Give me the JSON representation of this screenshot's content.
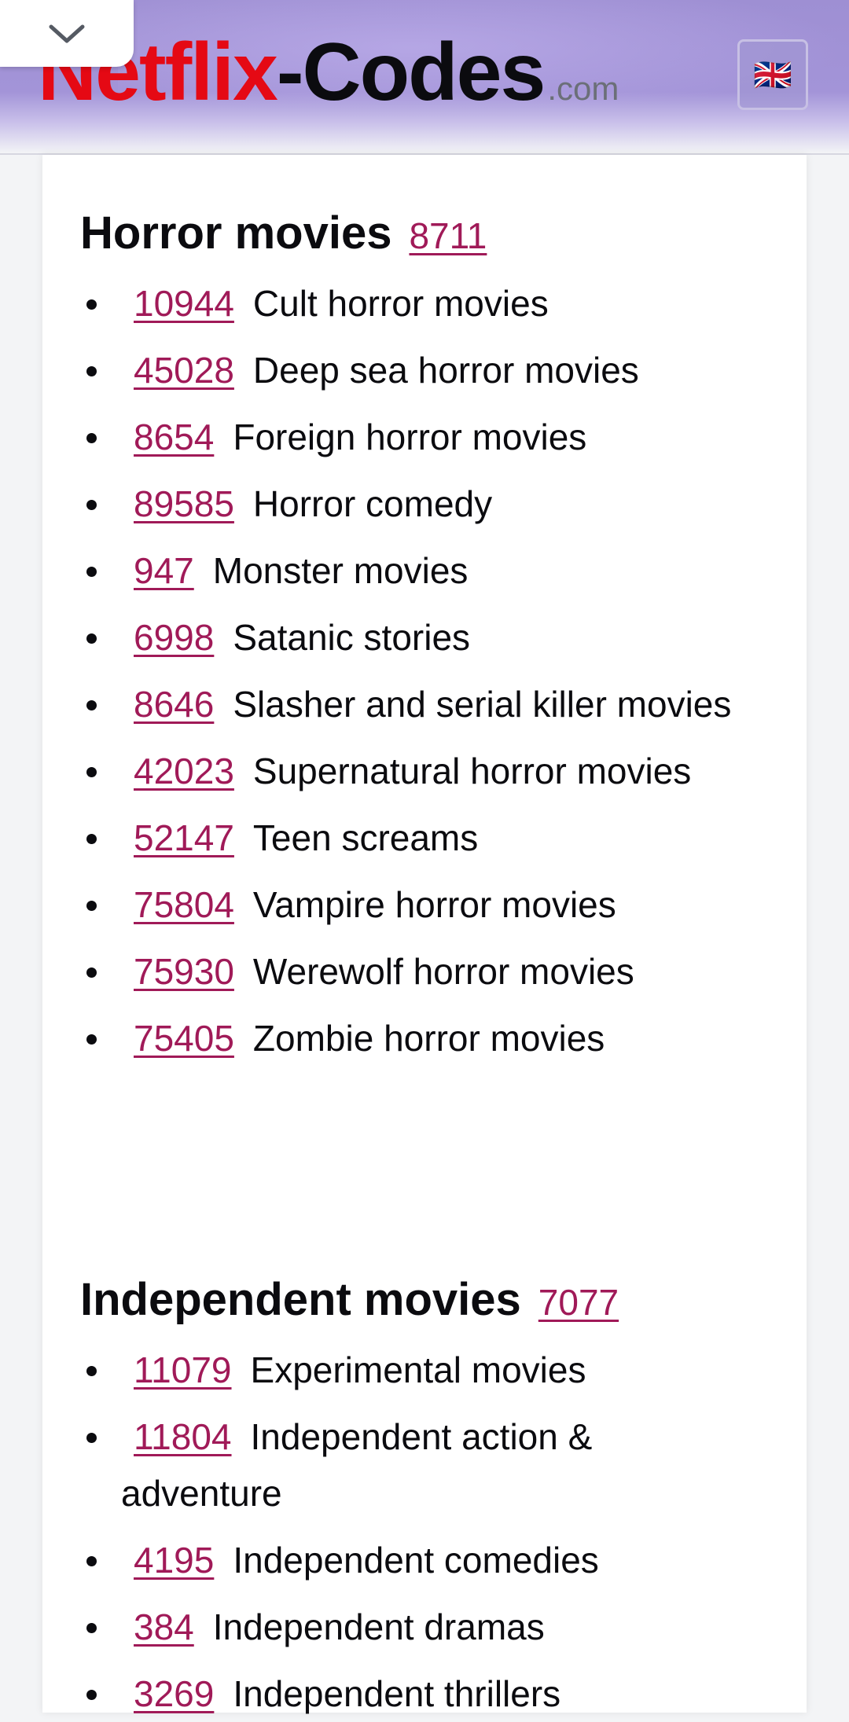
{
  "header": {
    "logo_part1": "Netflix",
    "logo_part2": "-Codes",
    "logo_suffix": ".com",
    "language_flag": "🇬🇧"
  },
  "sections": [
    {
      "title": "Horror movies",
      "code": "8711",
      "items": [
        {
          "code": "10944",
          "label": "Cult horror movies"
        },
        {
          "code": "45028",
          "label": "Deep sea horror movies"
        },
        {
          "code": "8654",
          "label": "Foreign horror movies"
        },
        {
          "code": "89585",
          "label": "Horror comedy"
        },
        {
          "code": "947",
          "label": "Monster movies"
        },
        {
          "code": "6998",
          "label": "Satanic stories"
        },
        {
          "code": "8646",
          "label": "Slasher and serial killer movies"
        },
        {
          "code": "42023",
          "label": "Supernatural horror movies"
        },
        {
          "code": "52147",
          "label": "Teen screams"
        },
        {
          "code": "75804",
          "label": "Vampire horror movies"
        },
        {
          "code": "75930",
          "label": "Werewolf horror movies"
        },
        {
          "code": "75405",
          "label": "Zombie horror movies"
        }
      ]
    },
    {
      "title": "Independent movies",
      "code": "7077",
      "items": [
        {
          "code": "11079",
          "label": "Experimental movies"
        },
        {
          "code": "11804",
          "label": "Independent action & adventure"
        },
        {
          "code": "4195",
          "label": "Independent comedies"
        },
        {
          "code": "384",
          "label": "Independent dramas"
        },
        {
          "code": "3269",
          "label": "Independent thrillers"
        }
      ]
    }
  ],
  "colors": {
    "link": "#a01a58",
    "brand_red": "#e50914",
    "header_purple": "#a394d8"
  }
}
